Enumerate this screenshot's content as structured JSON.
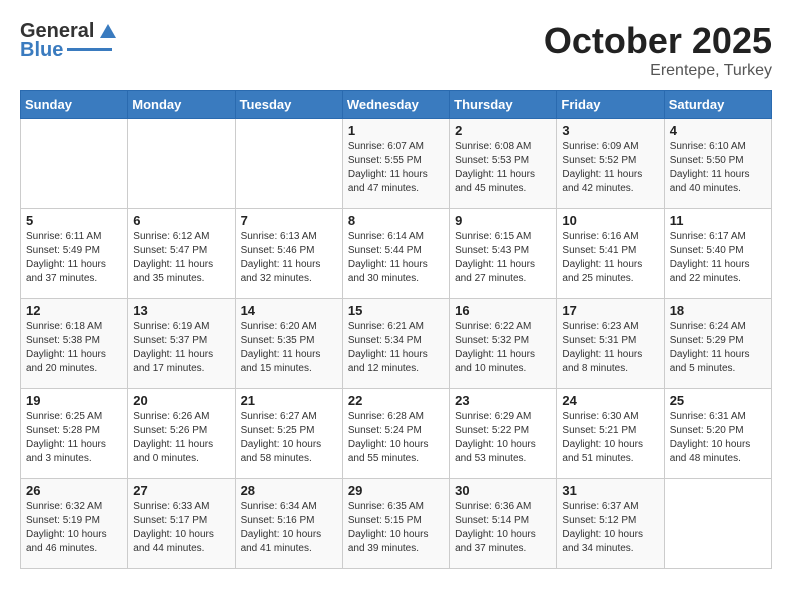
{
  "header": {
    "logo_general": "General",
    "logo_blue": "Blue",
    "month_title": "October 2025",
    "location": "Erentepe, Turkey"
  },
  "days_of_week": [
    "Sunday",
    "Monday",
    "Tuesday",
    "Wednesday",
    "Thursday",
    "Friday",
    "Saturday"
  ],
  "weeks": [
    {
      "cells": [
        {
          "day": "",
          "info": ""
        },
        {
          "day": "",
          "info": ""
        },
        {
          "day": "",
          "info": ""
        },
        {
          "day": "1",
          "info": "Sunrise: 6:07 AM\nSunset: 5:55 PM\nDaylight: 11 hours\nand 47 minutes."
        },
        {
          "day": "2",
          "info": "Sunrise: 6:08 AM\nSunset: 5:53 PM\nDaylight: 11 hours\nand 45 minutes."
        },
        {
          "day": "3",
          "info": "Sunrise: 6:09 AM\nSunset: 5:52 PM\nDaylight: 11 hours\nand 42 minutes."
        },
        {
          "day": "4",
          "info": "Sunrise: 6:10 AM\nSunset: 5:50 PM\nDaylight: 11 hours\nand 40 minutes."
        }
      ]
    },
    {
      "cells": [
        {
          "day": "5",
          "info": "Sunrise: 6:11 AM\nSunset: 5:49 PM\nDaylight: 11 hours\nand 37 minutes."
        },
        {
          "day": "6",
          "info": "Sunrise: 6:12 AM\nSunset: 5:47 PM\nDaylight: 11 hours\nand 35 minutes."
        },
        {
          "day": "7",
          "info": "Sunrise: 6:13 AM\nSunset: 5:46 PM\nDaylight: 11 hours\nand 32 minutes."
        },
        {
          "day": "8",
          "info": "Sunrise: 6:14 AM\nSunset: 5:44 PM\nDaylight: 11 hours\nand 30 minutes."
        },
        {
          "day": "9",
          "info": "Sunrise: 6:15 AM\nSunset: 5:43 PM\nDaylight: 11 hours\nand 27 minutes."
        },
        {
          "day": "10",
          "info": "Sunrise: 6:16 AM\nSunset: 5:41 PM\nDaylight: 11 hours\nand 25 minutes."
        },
        {
          "day": "11",
          "info": "Sunrise: 6:17 AM\nSunset: 5:40 PM\nDaylight: 11 hours\nand 22 minutes."
        }
      ]
    },
    {
      "cells": [
        {
          "day": "12",
          "info": "Sunrise: 6:18 AM\nSunset: 5:38 PM\nDaylight: 11 hours\nand 20 minutes."
        },
        {
          "day": "13",
          "info": "Sunrise: 6:19 AM\nSunset: 5:37 PM\nDaylight: 11 hours\nand 17 minutes."
        },
        {
          "day": "14",
          "info": "Sunrise: 6:20 AM\nSunset: 5:35 PM\nDaylight: 11 hours\nand 15 minutes."
        },
        {
          "day": "15",
          "info": "Sunrise: 6:21 AM\nSunset: 5:34 PM\nDaylight: 11 hours\nand 12 minutes."
        },
        {
          "day": "16",
          "info": "Sunrise: 6:22 AM\nSunset: 5:32 PM\nDaylight: 11 hours\nand 10 minutes."
        },
        {
          "day": "17",
          "info": "Sunrise: 6:23 AM\nSunset: 5:31 PM\nDaylight: 11 hours\nand 8 minutes."
        },
        {
          "day": "18",
          "info": "Sunrise: 6:24 AM\nSunset: 5:29 PM\nDaylight: 11 hours\nand 5 minutes."
        }
      ]
    },
    {
      "cells": [
        {
          "day": "19",
          "info": "Sunrise: 6:25 AM\nSunset: 5:28 PM\nDaylight: 11 hours\nand 3 minutes."
        },
        {
          "day": "20",
          "info": "Sunrise: 6:26 AM\nSunset: 5:26 PM\nDaylight: 11 hours\nand 0 minutes."
        },
        {
          "day": "21",
          "info": "Sunrise: 6:27 AM\nSunset: 5:25 PM\nDaylight: 10 hours\nand 58 minutes."
        },
        {
          "day": "22",
          "info": "Sunrise: 6:28 AM\nSunset: 5:24 PM\nDaylight: 10 hours\nand 55 minutes."
        },
        {
          "day": "23",
          "info": "Sunrise: 6:29 AM\nSunset: 5:22 PM\nDaylight: 10 hours\nand 53 minutes."
        },
        {
          "day": "24",
          "info": "Sunrise: 6:30 AM\nSunset: 5:21 PM\nDaylight: 10 hours\nand 51 minutes."
        },
        {
          "day": "25",
          "info": "Sunrise: 6:31 AM\nSunset: 5:20 PM\nDaylight: 10 hours\nand 48 minutes."
        }
      ]
    },
    {
      "cells": [
        {
          "day": "26",
          "info": "Sunrise: 6:32 AM\nSunset: 5:19 PM\nDaylight: 10 hours\nand 46 minutes."
        },
        {
          "day": "27",
          "info": "Sunrise: 6:33 AM\nSunset: 5:17 PM\nDaylight: 10 hours\nand 44 minutes."
        },
        {
          "day": "28",
          "info": "Sunrise: 6:34 AM\nSunset: 5:16 PM\nDaylight: 10 hours\nand 41 minutes."
        },
        {
          "day": "29",
          "info": "Sunrise: 6:35 AM\nSunset: 5:15 PM\nDaylight: 10 hours\nand 39 minutes."
        },
        {
          "day": "30",
          "info": "Sunrise: 6:36 AM\nSunset: 5:14 PM\nDaylight: 10 hours\nand 37 minutes."
        },
        {
          "day": "31",
          "info": "Sunrise: 6:37 AM\nSunset: 5:12 PM\nDaylight: 10 hours\nand 34 minutes."
        },
        {
          "day": "",
          "info": ""
        }
      ]
    }
  ]
}
